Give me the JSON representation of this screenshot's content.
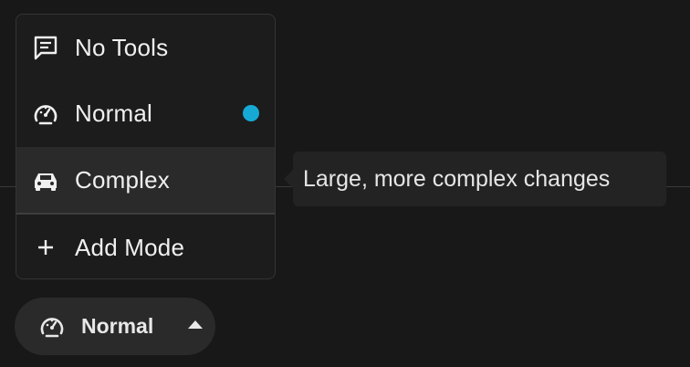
{
  "menu": {
    "items": [
      {
        "label": "No Tools",
        "icon": "message-lines-icon"
      },
      {
        "label": "Normal",
        "icon": "speedometer-icon",
        "active": true
      },
      {
        "label": "Complex",
        "icon": "car-icon",
        "hovered": true
      },
      {
        "label": "Add Mode",
        "icon": "plus-icon"
      }
    ],
    "active_indicator_color": "#17a9d6"
  },
  "tooltip": {
    "text": "Large, more complex changes"
  },
  "mode_button": {
    "label": "Normal",
    "icon": "speedometer-icon",
    "caret": "caret-up-icon"
  }
}
